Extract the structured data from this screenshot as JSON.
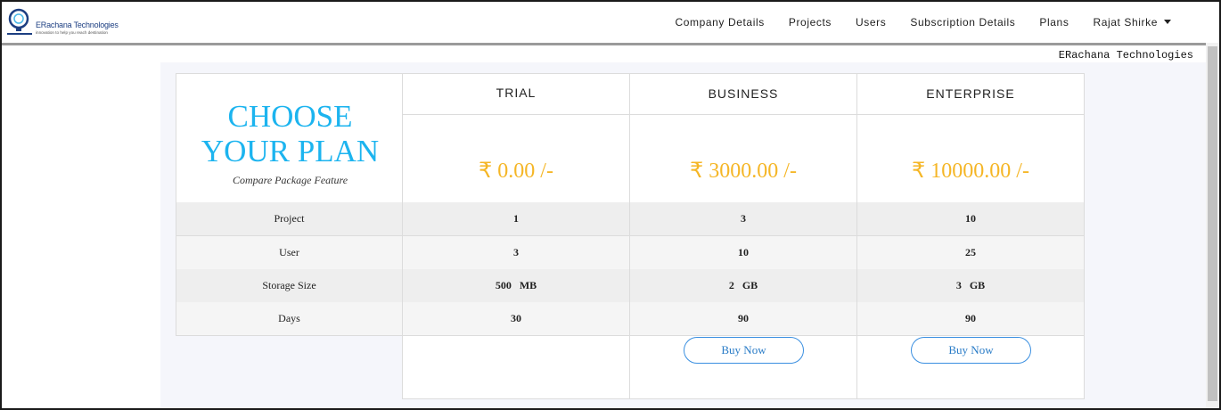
{
  "header": {
    "logo_name": "ERachana Technologies",
    "logo_tagline": "innovation to help you reach destination",
    "nav": [
      {
        "label": "Company Details"
      },
      {
        "label": "Projects"
      },
      {
        "label": "Users"
      },
      {
        "label": "Subscription Details"
      },
      {
        "label": "Plans"
      },
      {
        "label": "Rajat Shirke"
      }
    ]
  },
  "company_label": "ERachana Technologies",
  "intro": {
    "title_line1": "CHOOSE",
    "title_line2": "YOUR PLAN",
    "subtitle": "Compare Package Feature"
  },
  "plans": [
    {
      "name": "TRIAL",
      "price": "₹ 0.00 /-",
      "project": "1",
      "user": "3",
      "storage": "500   MB",
      "days": "30",
      "buy_label": ""
    },
    {
      "name": "BUSINESS",
      "price": "₹ 3000.00 /-",
      "project": "3",
      "user": "10",
      "storage": "2   GB",
      "days": "90",
      "buy_label": "Buy Now"
    },
    {
      "name": "ENTERPRISE",
      "price": "₹ 10000.00 /-",
      "project": "10",
      "user": "25",
      "storage": "3   GB",
      "days": "90",
      "buy_label": "Buy Now"
    }
  ],
  "features": {
    "project": "Project",
    "user": "User",
    "storage": "Storage Size",
    "days": "Days"
  },
  "colors": {
    "title": "#1cb4ef",
    "price": "#f5b626",
    "button_border": "#3a8fe0",
    "row_shade": "#eeeeee",
    "row_light": "#f5f5f5"
  }
}
